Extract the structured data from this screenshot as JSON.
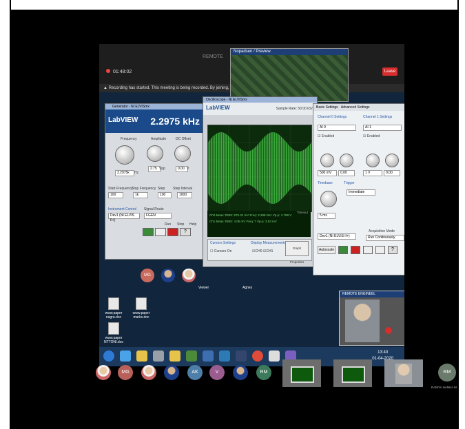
{
  "meeting": {
    "app_title": "REMOTE",
    "timer": "01:48:02",
    "leave_label": "Leave",
    "recording_text": "Recording has started. This meeting is being recorded. By joining, you are gi"
  },
  "preview_window": {
    "title": "Nopadsen / Preview"
  },
  "generator": {
    "window_title": "Generator - NI ELVISmx",
    "logo": "LabVIEW",
    "frequency_display": "2.2975 kHz",
    "sections": [
      "Frequency",
      "Amplitude",
      "DC Offset"
    ],
    "freq_value": "2.2975k",
    "freq_unit": "Hz",
    "amp_value": "2.75",
    "amp_unit": "Vpp",
    "offset_value": "0.00",
    "offset_unit": "V",
    "sweep_labels": [
      "Start Frequency",
      "Stop Frequency",
      "Step",
      "Step Interval"
    ],
    "sweep_values": [
      "100",
      "1k",
      "100",
      "1000"
    ],
    "signal_route_label": "Signal Route",
    "signal_route_value": "FGEN",
    "instrument_label": "Instrument Control",
    "instrument_value": "Dev1 (NI ELVIS II+)",
    "buttons": [
      "Run",
      "Stop",
      "Help"
    ]
  },
  "oscilloscope": {
    "window_title": "Oscilloscope - NI ELVISmx",
    "logo": "LabVIEW",
    "sample_rate": "Sample Rate: 50.00 kS/s",
    "ch0_meas": "Ch0 Meas: RMS: 575.31 mV  Freq: 2.298 kHz  Vp-p: 1.798 V",
    "ch1_meas": "Ch1 Meas: RMS: 4.05 mV  Freq: ?  Vp-p: 3.53 mV",
    "timeout": "Timeout",
    "cursors_label": "Cursors Settings",
    "cursors_on": "Cursors On",
    "display_meas": "Display Measurements",
    "graph_props": "Graph Properties"
  },
  "scope_settings": {
    "tabs": [
      "Basic Settings",
      "Advanced Settings"
    ],
    "ch0": "Channel 0 Settings",
    "ch1": "Channel 1 Settings",
    "source0": "AI 0",
    "source1": "AI 1",
    "enabled": "Enabled",
    "scale0": "500 mV",
    "scale1": "1 V",
    "pos0": "0.00",
    "pos1": "0.00",
    "timebase": "Timebase",
    "time_div": "5 ms",
    "trigger": "Trigger",
    "trig_type": "Immediate",
    "instrument": "Dev1 (NI ELVIS II+)",
    "acq_mode_label": "Acquisition Mode",
    "acq_mode": "Run Continuously",
    "autoscale": "Autoscale",
    "buttons": [
      "Run",
      "Stop",
      "Print",
      "Log",
      "Help"
    ]
  },
  "desktop": {
    "files": [
      "www.paper nagra.doc",
      "www.paper marks.doc",
      "www.paper NTTONI.doc"
    ]
  },
  "taskbar": {
    "time": "13:40",
    "date": "01-04-2020"
  },
  "video_thumb": {
    "title": "REMOTE ENGINEEL"
  },
  "inner_avatars": [
    "MG"
  ],
  "labels": {
    "viewer1": "Viewer",
    "viewer2": "Agnes"
  },
  "participants": {
    "initials": [
      "MG",
      "AK",
      "V",
      "RM",
      "RM"
    ],
    "rm_name": "RAMYA HANKA M"
  }
}
